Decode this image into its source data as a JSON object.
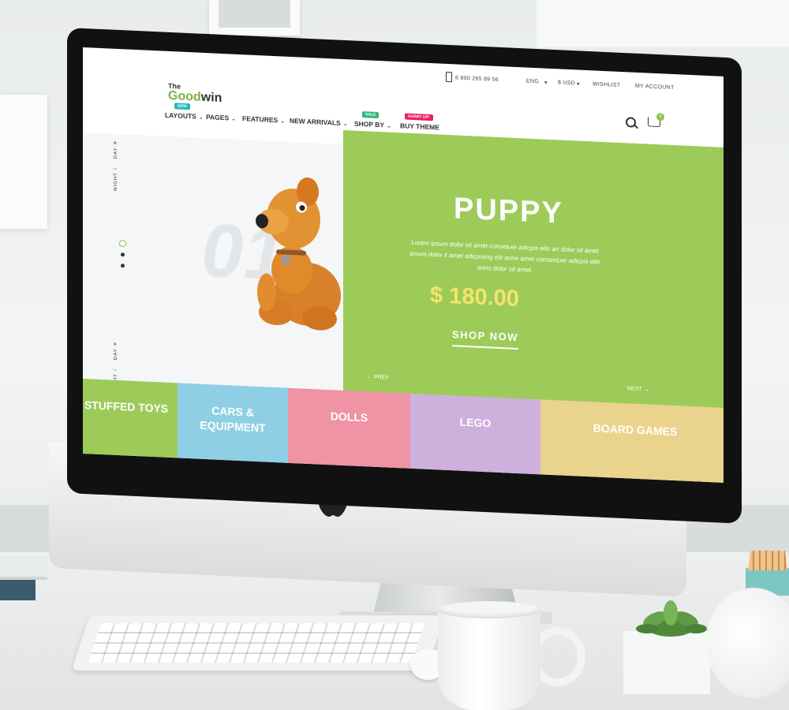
{
  "site": {
    "logo_the": "The",
    "logo_good": "Good",
    "logo_win": "win",
    "accent_color": "#9ccb59"
  },
  "topbar": {
    "phone": "8 800 265 89 56",
    "language": "ENG",
    "currency": "$ USD",
    "wishlist": "WISHLIST",
    "account": "MY ACCOUNT"
  },
  "nav": {
    "items": [
      {
        "label": "LAYOUTS",
        "badge": "NEW",
        "badge_color": "#29b6b8"
      },
      {
        "label": "PAGES",
        "badge": "",
        "badge_color": ""
      },
      {
        "label": "FEATURES",
        "badge": "",
        "badge_color": ""
      },
      {
        "label": "NEW ARRIVALS",
        "badge": "",
        "badge_color": ""
      },
      {
        "label": "SHOP BY",
        "badge": "SALE",
        "badge_color": "#2dba7b"
      },
      {
        "label": "BUY THEME",
        "badge": "HURRY UP!",
        "badge_color": "#e91e63"
      }
    ]
  },
  "header_icons": {
    "search": "search-icon",
    "cart": "cart-icon",
    "cart_count": "0"
  },
  "side_switch": {
    "day": "DAY",
    "night": "NIGHT"
  },
  "hero": {
    "slide_number": "01",
    "title": "PUPPY",
    "description": "Lorem ipsum dolor sit amet consetuer adicpis elitr an dolor sit amet ipsum dolor it amet adicpising elit anno amet consestuer adicpis elitr anno dolor sit amet.",
    "price": "$ 180.00",
    "cta": "SHOP NOW",
    "prev": "PREV",
    "next": "NEXT"
  },
  "categories": [
    {
      "label": "STUFFED TOYS",
      "color": "#9ccb59"
    },
    {
      "label": "CARS & EQUIPMENT",
      "color": "#8fcfe5"
    },
    {
      "label": "DOLLS",
      "color": "#ef93a5"
    },
    {
      "label": "LEGO",
      "color": "#cdb0dc"
    },
    {
      "label": "BOARD GAMES",
      "color": "#ead38c"
    }
  ]
}
